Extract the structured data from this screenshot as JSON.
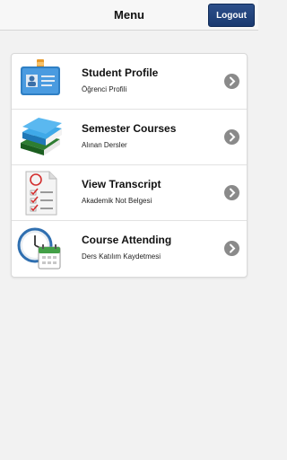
{
  "header": {
    "title": "Menu",
    "logout_label": "Logout"
  },
  "menu": {
    "items": [
      {
        "label": "Student Profile",
        "sub": "Öğrenci Profili",
        "icon": "id-badge-icon"
      },
      {
        "label": "Semester Courses",
        "sub": "Alınan Dersler",
        "icon": "books-icon"
      },
      {
        "label": "View Transcript",
        "sub": "Akademik Not Belgesi",
        "icon": "transcript-icon"
      },
      {
        "label": "Course Attending",
        "sub": "Ders Katılım Kaydetmesi",
        "icon": "clock-calendar-icon"
      }
    ]
  },
  "colors": {
    "logout_bg": "#1f3f78",
    "chevron": "#8a8a8a",
    "background": "#f2f2f2"
  }
}
